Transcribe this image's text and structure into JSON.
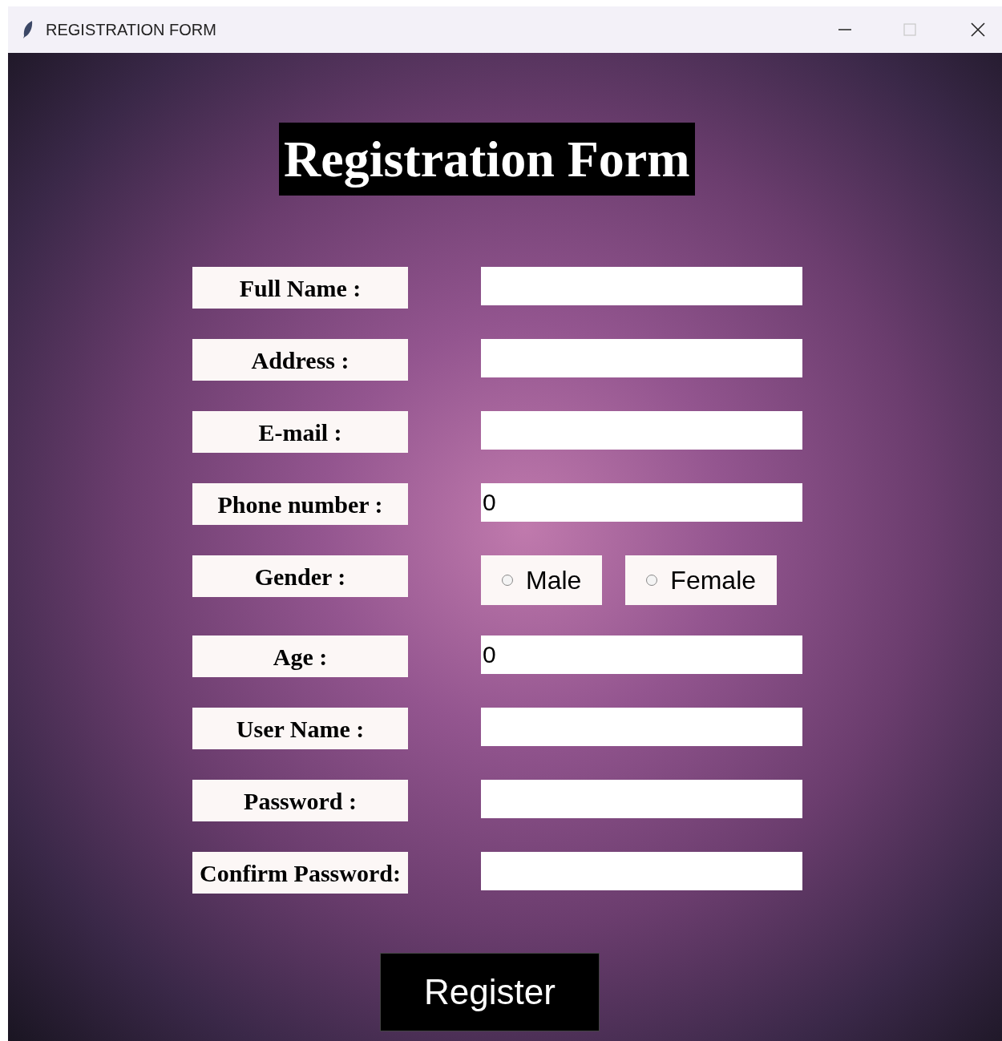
{
  "window": {
    "title": "REGISTRATION FORM"
  },
  "heading": "Registration Form",
  "fields": [
    {
      "kind": "entry",
      "label": "Full Name :"
    },
    {
      "kind": "entry",
      "label": "Address :"
    },
    {
      "kind": "entry",
      "label": "E-mail :"
    },
    {
      "kind": "entry",
      "label": "Phone number :",
      "value": "0"
    },
    {
      "kind": "radio",
      "label": "Gender :",
      "options": [
        {
          "label": "Male",
          "selected": false
        },
        {
          "label": "Female",
          "selected": false
        }
      ]
    },
    {
      "kind": "entry",
      "label": "Age :",
      "value": "0"
    },
    {
      "kind": "entry",
      "label": "User Name :"
    },
    {
      "kind": "entry",
      "label": "Password :"
    },
    {
      "kind": "entry",
      "label": "Confirm Password:"
    }
  ],
  "button": "Register"
}
